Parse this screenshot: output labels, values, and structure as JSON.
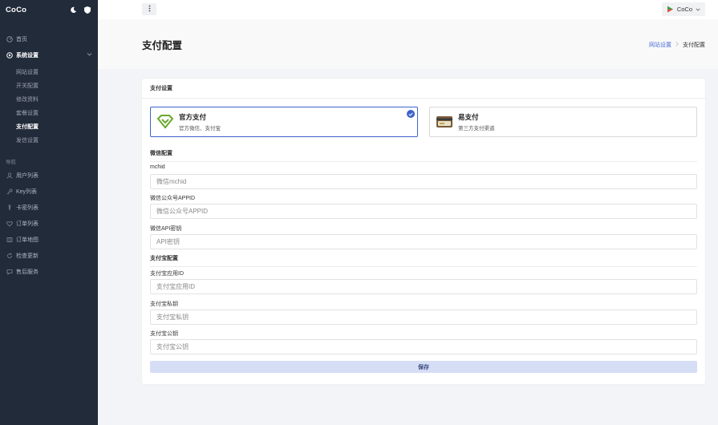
{
  "app": {
    "brand": "CoCo"
  },
  "sidebar": {
    "home": "首页",
    "system": "系统设置",
    "sub_items": [
      "网站设置",
      "开关配置",
      "修改资料",
      "套餐设置",
      "支付配置",
      "发信设置"
    ],
    "active_sub_index": 4,
    "section_title": "导航",
    "nav_items": [
      "用户列表",
      "Key列表",
      "卡密列表",
      "订单列表",
      "订单地图",
      "检查更新",
      "售后服务"
    ]
  },
  "topbar": {
    "user": "CoCo"
  },
  "page": {
    "title": "支付配置",
    "breadcrumb": {
      "link": "网站设置",
      "current": "支付配置"
    }
  },
  "card": {
    "title": "支付设置",
    "options": [
      {
        "title": "官方支付",
        "desc": "官方微信、支付宝",
        "selected": true
      },
      {
        "title": "易支付",
        "desc": "第三方支付渠道",
        "selected": false
      }
    ],
    "wechat_section": "微信配置",
    "alipay_section": "支付宝配置",
    "fields": [
      {
        "label": "mchid",
        "placeholder": "微信mchid"
      },
      {
        "label": "微信公众号APPID",
        "placeholder": "微信公众号APPID"
      },
      {
        "label": "微信API密钥",
        "placeholder": "API密钥"
      },
      {
        "label": "支付宝应用ID",
        "placeholder": "支付宝应用ID"
      },
      {
        "label": "支付宝私钥",
        "placeholder": "支付宝私钥"
      },
      {
        "label": "支付宝公钥",
        "placeholder": "支付宝公钥"
      }
    ],
    "save_label": "保存"
  },
  "colors": {
    "sidebar_bg": "#222b3a",
    "accent": "#3d63c9",
    "save_bg": "#d6def6"
  }
}
